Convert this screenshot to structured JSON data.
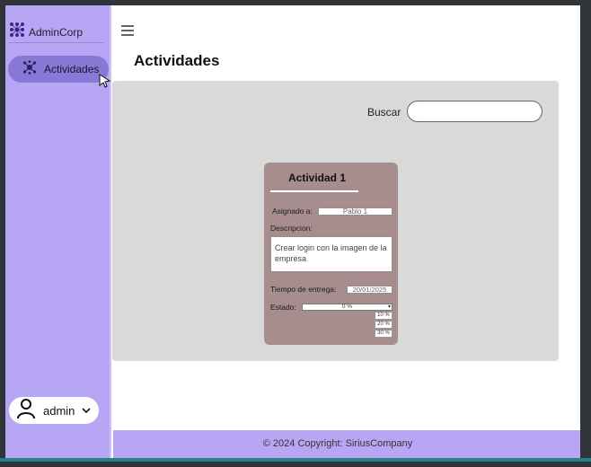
{
  "app": {
    "brand_name": "AdminCorp"
  },
  "sidebar": {
    "items": [
      {
        "label": "Actividades",
        "icon": "sitemap-icon",
        "active": true
      }
    ],
    "user": {
      "name": "admin"
    }
  },
  "header": {
    "menu_icon": "hamburger-icon"
  },
  "main": {
    "title": "Actividades",
    "search": {
      "label": "Buscar",
      "value": "",
      "placeholder": ""
    },
    "cards": [
      {
        "title": "Actividad 1",
        "assigned_label": "Asignado a:",
        "assigned_value": "Pablo 1",
        "description_label": "Descripcion:",
        "description_value": "Crear login con la imagen de la empresa",
        "deadline_label": "Tiempo de entrega:",
        "deadline_value": "20/01/2025",
        "status_label": "Estado:",
        "status_value": "0 %",
        "status_options": [
          "10 %",
          "20 %",
          "30 %"
        ]
      }
    ]
  },
  "footer": {
    "text": "© 2024 Copyright: SiriusCompany"
  },
  "colors": {
    "sidebar": "#b6a6f4",
    "nav_active": "#8a78d6",
    "card": "#a78d8d",
    "panel": "#d9d9d9"
  }
}
